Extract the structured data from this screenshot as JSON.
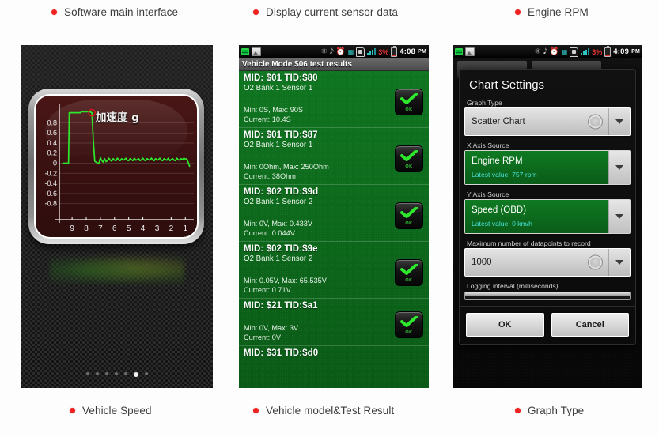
{
  "captions_top": [
    {
      "label": "Software main interface",
      "dot_color": "#ef2222"
    },
    {
      "label": "Display current sensor data",
      "dot_color": "#ef2222"
    },
    {
      "label": "Engine RPM",
      "dot_color": "#ef2222"
    }
  ],
  "captions_bottom": [
    {
      "label": "Vehicle Speed",
      "dot_color": "#ef2222"
    },
    {
      "label": "Vehicle model&Test Result",
      "dot_color": "#ef2222"
    },
    {
      "label": "Graph Type",
      "dot_color": "#ef2222"
    }
  ],
  "phone1": {
    "widget_title": "加速度 g",
    "chart_data": {
      "type": "line",
      "title": "加速度 g",
      "xlabel": "",
      "ylabel": "",
      "ylim": [
        -1.0,
        1.0
      ],
      "yticks": [
        0.8,
        0.6,
        0.4,
        0.2,
        0,
        -0.2,
        -0.4,
        -0.6,
        -0.8
      ],
      "ytick_labels": [
        "0.8",
        "0.6",
        "0.4",
        "0.2",
        "0",
        "-0.2",
        "-0.4",
        "-0.6",
        "-0.8"
      ],
      "xticks": [
        9,
        8,
        7,
        6,
        5,
        4,
        3,
        2,
        1
      ],
      "xtick_labels": [
        "9",
        "8",
        "7",
        "6",
        "5",
        "4",
        "3",
        "2",
        "1"
      ],
      "grid": true,
      "line_color": "#2ee82e",
      "marker": {
        "x": 7.6,
        "y": 1.0,
        "color": "#d81919",
        "shape": "circle-outline"
      },
      "series": [
        {
          "name": "加速度 g",
          "x": [
            9.6,
            9.3,
            9.25,
            9.2,
            8.4,
            8.35,
            7.75,
            7.6,
            7.5,
            7.4,
            7.3,
            7.2,
            7.1,
            7.0,
            6.9,
            6.8,
            6.7,
            6.6,
            6.5,
            6.4,
            6.3,
            6.2,
            6.1,
            6.0,
            5.9,
            5.8,
            5.7,
            5.6,
            5.5,
            5.4,
            5.3,
            5.2,
            5.1,
            5.0,
            4.9,
            4.8,
            4.7,
            4.6,
            4.5,
            4.4,
            4.3,
            4.2,
            4.1,
            4.0,
            3.9,
            3.8,
            3.7,
            3.6,
            3.5,
            3.4,
            3.3,
            3.2,
            3.1,
            3.0,
            2.9,
            2.8,
            2.7,
            2.6,
            2.5,
            2.4,
            2.3,
            2.2,
            2.1,
            2.0,
            1.9,
            1.8,
            1.7,
            1.6,
            1.5,
            1.4,
            1.3,
            1.2,
            1.1,
            1.0,
            0.9,
            0.8,
            0.7
          ],
          "y": [
            0.0,
            0.0,
            0.0,
            1.0,
            1.0,
            1.02,
            1.02,
            1.0,
            0.45,
            0.04,
            0.02,
            0.0,
            0.0,
            0.11,
            0.05,
            0.02,
            0.09,
            0.03,
            0.05,
            0.1,
            0.06,
            0.04,
            0.09,
            0.06,
            0.05,
            0.1,
            0.07,
            0.05,
            0.09,
            0.06,
            0.07,
            0.1,
            0.06,
            0.05,
            0.09,
            0.07,
            0.05,
            0.1,
            0.06,
            0.07,
            0.09,
            0.05,
            0.07,
            0.1,
            0.06,
            0.05,
            0.09,
            0.07,
            0.06,
            0.1,
            0.07,
            0.05,
            0.09,
            0.06,
            0.07,
            0.1,
            0.06,
            0.05,
            0.09,
            0.07,
            0.06,
            0.1,
            0.05,
            0.07,
            0.09,
            0.06,
            0.05,
            0.1,
            0.07,
            0.06,
            0.09,
            0.07,
            0.1,
            0.08,
            0.09,
            0.02,
            -0.06
          ]
        }
      ]
    },
    "page_dots": {
      "count": 7,
      "active_index": 5
    }
  },
  "phone2": {
    "statusbar": {
      "left_icons": [
        "download-icon",
        "image-icon"
      ],
      "right_icons": [
        "bluetooth-icon",
        "mute-icon",
        "alarm-icon",
        "usb-icon",
        "sdcard-icon",
        "signal-bars-icon"
      ],
      "battery_percent": "3%",
      "time": "4:08",
      "ampm": "PM"
    },
    "app_title": "Vehicle Mode $06 test results",
    "results": [
      {
        "mid": "MID: $01 TID:$80",
        "sensor": "O2 Bank 1 Sensor 1",
        "range": "Min: 0S, Max: 90S",
        "current": "Current: 10.4S",
        "status": "OK"
      },
      {
        "mid": "MID: $01 TID:$87",
        "sensor": "O2 Bank 1 Sensor 1",
        "range": "Min: 0Ohm, Max: 250Ohm",
        "current": "Current: 38Ohm",
        "status": "OK"
      },
      {
        "mid": "MID: $02 TID:$9d",
        "sensor": "O2 Bank 1 Sensor 2",
        "range": "Min: 0V, Max: 0.433V",
        "current": "Current: 0.044V",
        "status": "OK"
      },
      {
        "mid": "MID: $02 TID:$9e",
        "sensor": "O2 Bank 1 Sensor 2",
        "range": "Min: 0.05V, Max: 65.535V",
        "current": "Current: 0.71V",
        "status": "OK"
      },
      {
        "mid": "MID: $21 TID:$a1",
        "sensor": "",
        "range": "Min: 0V, Max: 3V",
        "current": "Current: 0V",
        "status": "OK"
      },
      {
        "mid": "MID: $31 TID:$d0",
        "sensor": "",
        "range": "",
        "current": "",
        "status": ""
      }
    ]
  },
  "phone3": {
    "statusbar": {
      "battery_percent": "3%",
      "time": "4:09",
      "ampm": "PM"
    },
    "dialog": {
      "title": "Chart Settings",
      "graph_type": {
        "label": "Graph Type",
        "value": "Scatter Chart"
      },
      "x_axis": {
        "label": "X Axis Source",
        "value": "Engine RPM",
        "latest": "Latest value: 757 rpm"
      },
      "y_axis": {
        "label": "Y Axis Source",
        "value": "Speed (OBD)",
        "latest": "Latest value: 0 km/h"
      },
      "max_datapoints": {
        "label": "Maximum number of datapoints to record",
        "value": "1000"
      },
      "logging_interval": {
        "label": "Logging interval (milliseconds)"
      },
      "ok_label": "OK",
      "cancel_label": "Cancel"
    }
  },
  "colors": {
    "accent_red": "#ef2222",
    "android_green": "#0d6b1b",
    "chart_line": "#2ee82e",
    "cyan_value": "#49e2d9"
  }
}
